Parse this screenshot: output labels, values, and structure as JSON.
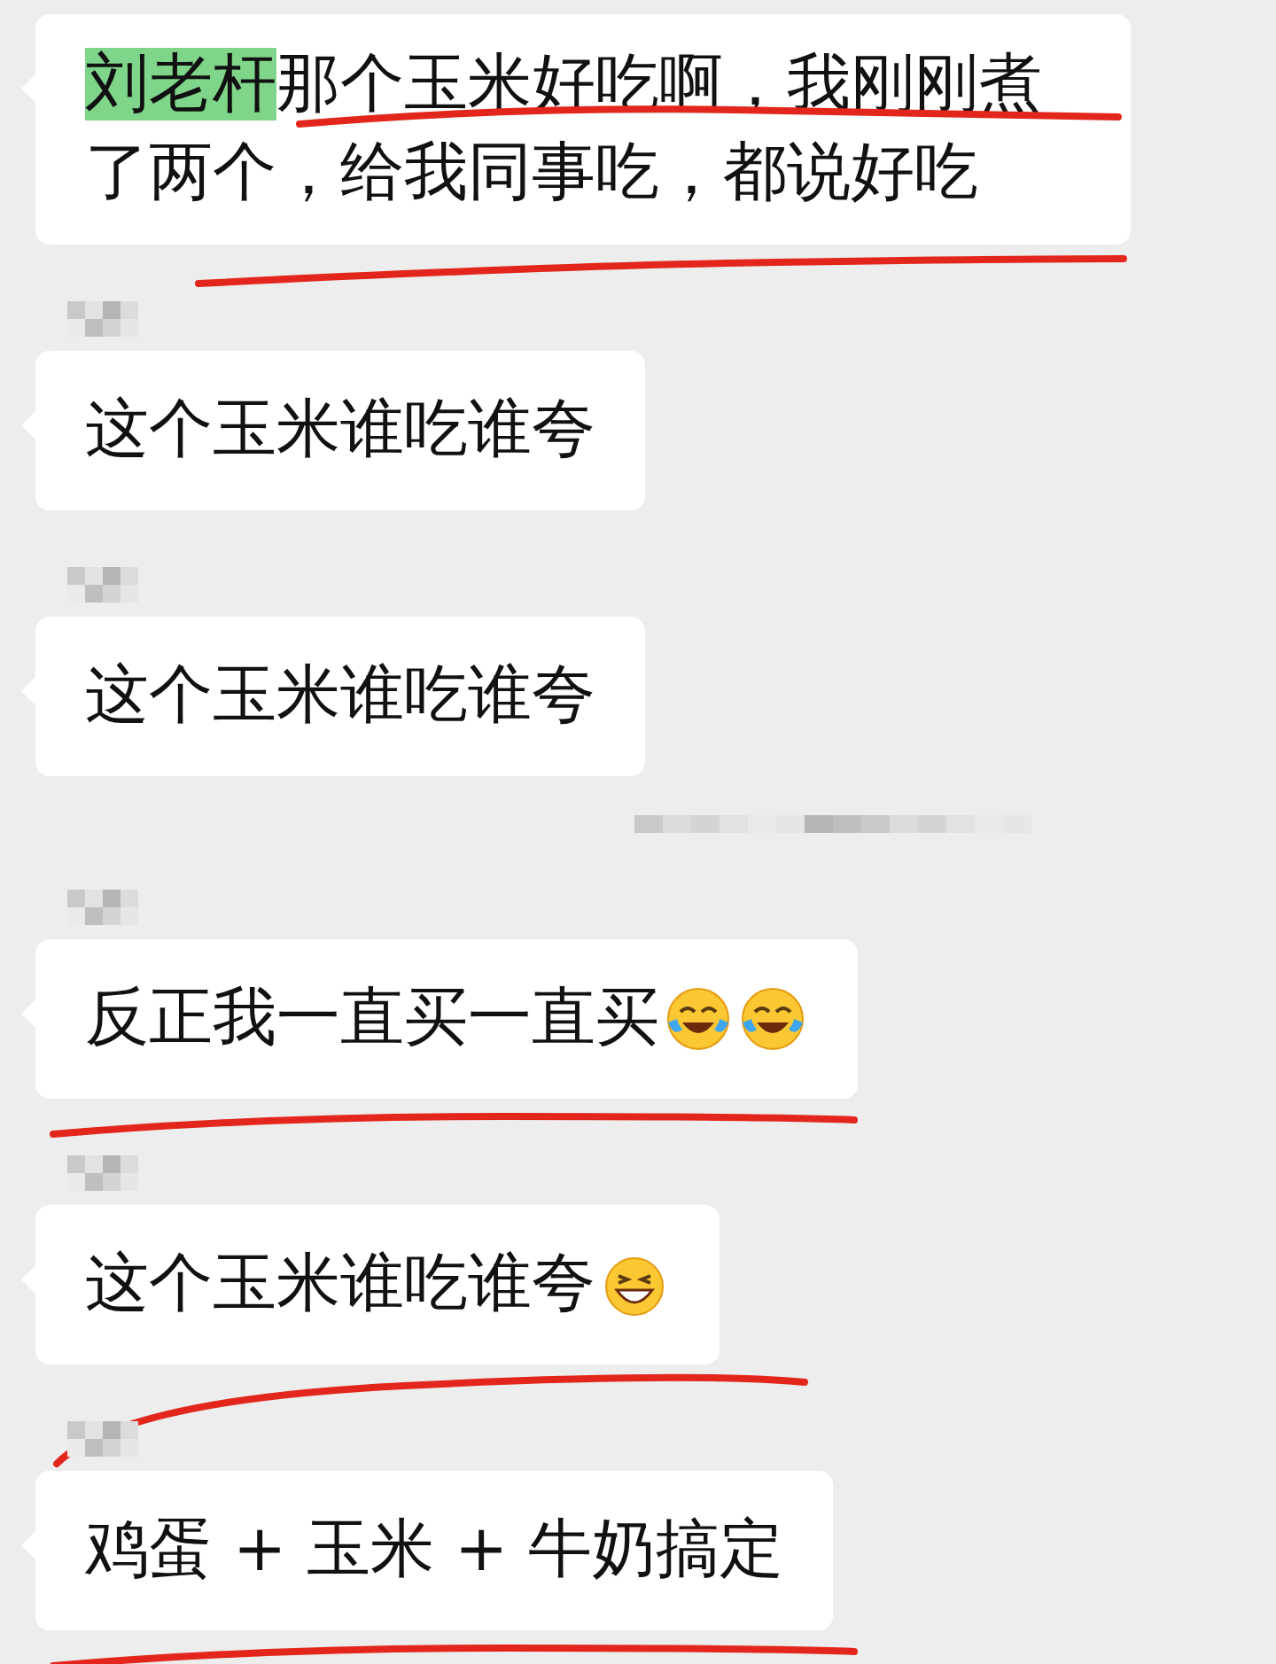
{
  "messages": [
    {
      "kind": "message",
      "sender_blurred": false,
      "highlight": "刘老杆",
      "text": "那个玉米好吃啊，我刚刚煮了两个，给我同事吃，都说好吃",
      "underline": {
        "kind": "double"
      },
      "wide": true
    },
    {
      "kind": "message",
      "sender_blurred": true,
      "text": "这个玉米谁吃谁夸"
    },
    {
      "kind": "message",
      "sender_blurred": true,
      "text": "这个玉米谁吃谁夸"
    },
    {
      "kind": "timestamp"
    },
    {
      "kind": "message",
      "sender_blurred": true,
      "text": "反正我一直买一直买",
      "emojis": [
        {
          "kind": "tears-of-joy"
        },
        {
          "kind": "tears-of-joy"
        }
      ],
      "underline": {
        "kind": "single"
      }
    },
    {
      "kind": "message",
      "sender_blurred": true,
      "text": "这个玉米谁吃谁夸",
      "emojis": [
        {
          "kind": "grinning"
        }
      ],
      "underline": {
        "kind": "swoosh"
      }
    },
    {
      "kind": "message",
      "sender_blurred": true,
      "text": "鸡蛋 + 玉米 + 牛奶搞定",
      "underline": {
        "kind": "single"
      }
    }
  ]
}
